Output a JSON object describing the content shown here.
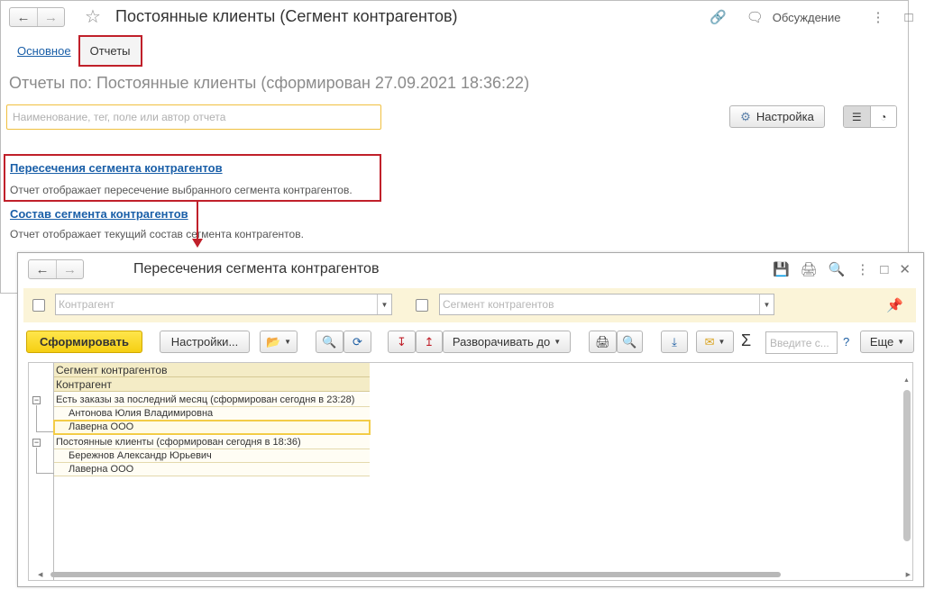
{
  "back_window": {
    "title": "Постоянные клиенты (Сегмент контрагентов)",
    "discussion_label": "Обсуждение",
    "tabs": [
      "Основное",
      "Отчеты"
    ],
    "reports_heading": "Отчеты по: Постоянные клиенты (сформирован 27.09.2021 18:36:22)",
    "search_placeholder": "Наименование, тег, поле или автор отчета",
    "settings_button": "Настройка",
    "reports": [
      {
        "title": "Пересечения сегмента контрагентов",
        "description": "Отчет отображает пересечение выбранного сегмента контрагентов."
      },
      {
        "title": "Состав сегмента контрагентов",
        "description": "Отчет отображает текущий состав сегмента контрагентов."
      }
    ]
  },
  "front_window": {
    "title": "Пересечения сегмента контрагентов",
    "filters": {
      "counterparty_placeholder": "Контрагент",
      "segment_placeholder": "Сегмент контрагентов"
    },
    "toolbar": {
      "generate": "Сформировать",
      "settings": "Настройки...",
      "expand_to": "Разворачивать до",
      "search_placeholder": "Введите с...",
      "help": "?",
      "more": "Еще"
    },
    "grid": {
      "headers": [
        "Сегмент контрагентов",
        "Контрагент"
      ],
      "groups": [
        {
          "label": "Есть заказы за последний месяц (сформирован сегодня в 23:28)",
          "items": [
            "Антонова Юлия Владимировна",
            "Лаверна ООО"
          ]
        },
        {
          "label": "Постоянные клиенты (сформирован сегодня в 18:36)",
          "items": [
            "Бережнов Александр Юрьевич",
            "Лаверна ООО"
          ]
        }
      ]
    }
  },
  "colors": {
    "highlight_red": "#c0202a",
    "link_blue": "#1a5fa8",
    "primary_yellow": "#f5cf12",
    "filter_bar_bg": "#fbf4d8"
  }
}
